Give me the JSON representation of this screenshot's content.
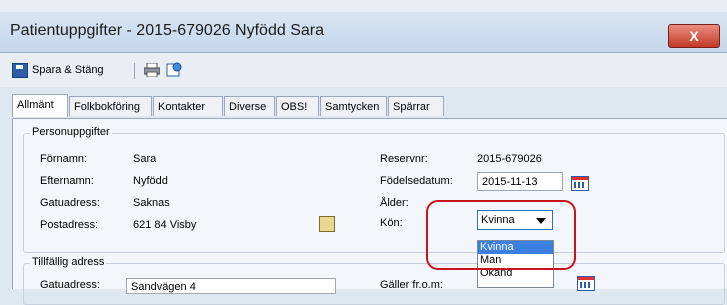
{
  "window": {
    "title": "Patientuppgifter - 2015-679026 Nyfödd Sara",
    "close_glyph": "X"
  },
  "toolbar": {
    "save_label": "Spara & Stäng"
  },
  "tabs": [
    "Allmänt",
    "Folkbokföring",
    "Kontakter",
    "Diverse",
    "OBS!",
    "Samtycken",
    "Spärrar"
  ],
  "personuppgifter": {
    "title": "Personuppgifter",
    "fornamn_label": "Förnamn:",
    "fornamn_value": "Sara",
    "efternamn_label": "Efternamn:",
    "efternamn_value": "Nyfödd",
    "gatuadress_label": "Gatuadress:",
    "gatuadress_value": "Saknas",
    "postadress_label": "Postadress:",
    "postadress_value": "621 84 Visby",
    "reservnr_label": "Reservnr:",
    "reservnr_value": "2015-679026",
    "fodelsedatum_label": "Födelsedatum:",
    "fodelsedatum_value": "2015-11-13",
    "alder_label": "Ålder:",
    "kon_label": "Kön:",
    "kon_selected": "Kvinna",
    "kon_options": [
      "Kvinna",
      "Man",
      "Okänd"
    ]
  },
  "tillfallig": {
    "title": "Tillfällig adress",
    "gatuadress_label": "Gatuadress:",
    "gatuadress_value": "Sandvägen 4",
    "galler_label": "Gäller fr.o.m:"
  },
  "colors": {
    "highlight": "#c8141c",
    "selection": "#3b7fe0",
    "close": "#c33a28"
  }
}
